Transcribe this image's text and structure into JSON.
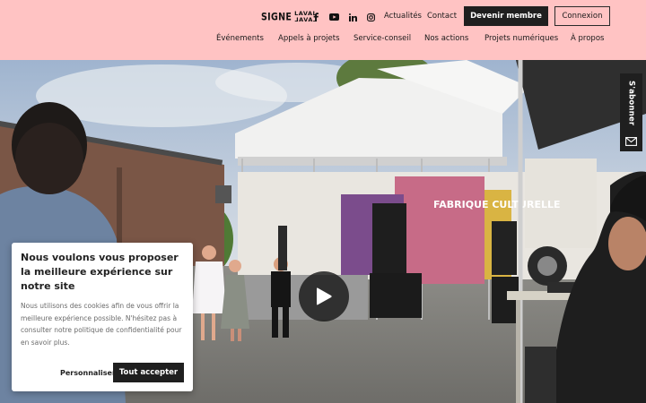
{
  "header": {
    "logo": {
      "main": "SIGNE",
      "stack_top": "LAVAL",
      "stack_bottom": "LAVAL"
    },
    "social": [
      {
        "name": "facebook-icon"
      },
      {
        "name": "youtube-icon"
      },
      {
        "name": "linkedin-icon"
      },
      {
        "name": "instagram-icon"
      }
    ],
    "links": {
      "actualites": "Actualités",
      "contact": "Contact"
    },
    "member_button": "Devenir membre",
    "login_button": "Connexion",
    "nav": [
      "Événements",
      "Appels à projets",
      "Service-conseil",
      "Nos actions",
      "Projets numériques",
      "À propos"
    ]
  },
  "hero": {
    "banner_text": "FABRIQUE CULTURELLE",
    "play_icon": "play-icon"
  },
  "subscribe": {
    "label": "S'abonner",
    "icon": "envelope-icon"
  },
  "cookie": {
    "title": "Nous voulons vous proposer la meilleure expérience sur notre site",
    "text": "Nous utilisons des cookies afin de vous offrir la meilleure expérience possible. N'hésitez pas à consulter notre politique de confidentialité pour en savoir plus.",
    "customize": "Personnaliser",
    "accept": "Tout accepter"
  },
  "colors": {
    "header_bg": "#ffc3c3",
    "dark": "#1f1f1f"
  }
}
